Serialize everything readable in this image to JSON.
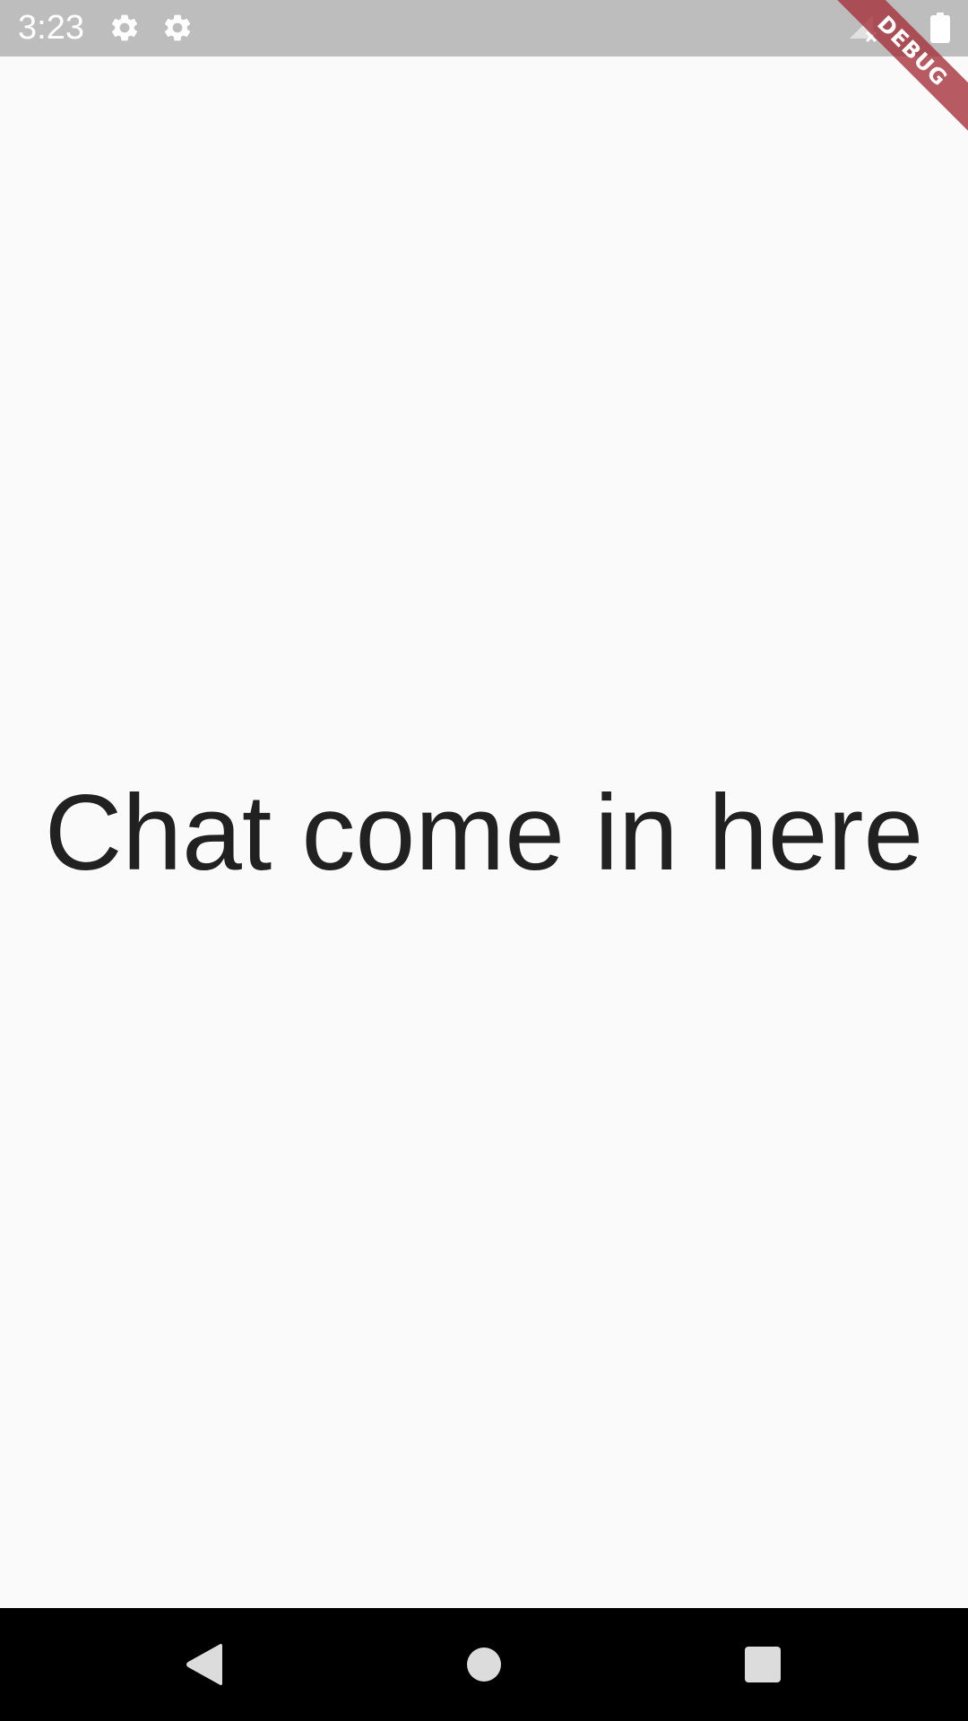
{
  "status_bar": {
    "time": "3:23",
    "icons": [
      "gear-icon",
      "gear-icon",
      "battery-icon"
    ],
    "background_color": "#bdbdbd"
  },
  "debug_banner": {
    "label": "DEBUG",
    "color": "#a52d37"
  },
  "main": {
    "text": "Chat come in here",
    "text_color": "#212121",
    "background_color": "#fafafa"
  },
  "nav_bar": {
    "buttons": [
      "back-icon",
      "home-icon",
      "recents-icon"
    ],
    "background_color": "#000000"
  }
}
